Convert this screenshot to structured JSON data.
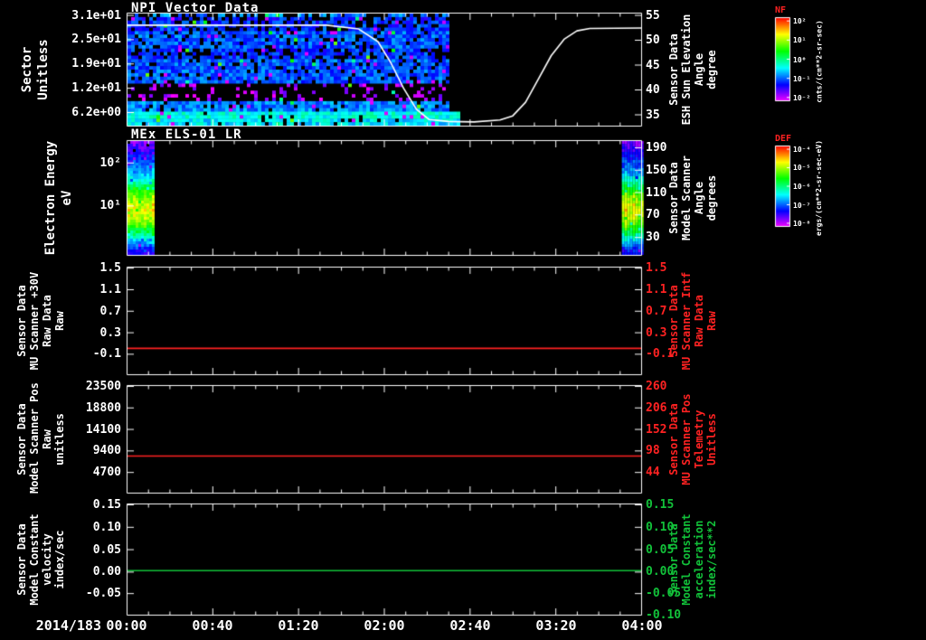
{
  "figure": {
    "background": "#000000",
    "foreground": "#ffffff"
  },
  "x_axis": {
    "date_label": "2014/183",
    "tick_labels": [
      "00:00",
      "00:40",
      "01:20",
      "02:00",
      "02:40",
      "03:20",
      "04:00"
    ],
    "range_hours": [
      0,
      4
    ]
  },
  "colorbars": [
    {
      "name": "NF",
      "name_color": "#ff2222",
      "unit_label": "cnts/(cm**2-sr-sec)",
      "tick_labels": [
        "10²",
        "10¹",
        "10⁰",
        "10⁻¹",
        "10⁻²"
      ]
    },
    {
      "name": "DEF",
      "name_color": "#ff2222",
      "unit_label": "ergs/(cm**2-sr-sec-eV)",
      "tick_labels": [
        "10⁻⁴",
        "10⁻⁵",
        "10⁻⁶",
        "10⁻⁷",
        "10⁻⁸"
      ]
    }
  ],
  "panels": [
    {
      "title": "NPI Vector Data",
      "left_axis": {
        "label_lines": [
          "Sector",
          "Unitless"
        ],
        "tick_labels": [
          "3.1e+01",
          "2.5e+01",
          "1.9e+01",
          "1.2e+01",
          "6.2e+00"
        ],
        "color": "#ffffff"
      },
      "right_axis": {
        "label_lines": [
          "Sensor Data",
          "ESH Sun Elevation",
          "Angle",
          "degree"
        ],
        "tick_labels": [
          "55",
          "50",
          "45",
          "40",
          "35"
        ],
        "color": "#ffffff"
      }
    },
    {
      "title": "MEx ELS-01 LR",
      "left_axis": {
        "label_lines": [
          "Electron Energy",
          "eV"
        ],
        "tick_labels": [
          "10²",
          "10¹"
        ],
        "color": "#ffffff"
      },
      "right_axis": {
        "label_lines": [
          "Sensor Data",
          "Model Scanner",
          "Angle",
          "degrees"
        ],
        "tick_labels": [
          "190",
          "150",
          "110",
          "70",
          "30"
        ],
        "color": "#ffffff"
      }
    },
    {
      "title": "",
      "left_axis": {
        "label_lines": [
          "Sensor Data",
          "MU Scanner +30V",
          "Raw Data",
          "Raw"
        ],
        "tick_labels": [
          "1.5",
          "1.1",
          "0.7",
          "0.3",
          "-0.1"
        ],
        "color": "#ffffff"
      },
      "right_axis": {
        "label_lines": [
          "Sensor Data",
          "MU Scanner Intf",
          "Raw Data",
          "Raw"
        ],
        "tick_labels": [
          "1.5",
          "1.1",
          "0.7",
          "0.3",
          "-0.1"
        ],
        "color": "#ff2222"
      }
    },
    {
      "title": "",
      "left_axis": {
        "label_lines": [
          "Sensor Data",
          "Model Scanner Pos",
          "Raw",
          "unitless"
        ],
        "tick_labels": [
          "23500",
          "18800",
          "14100",
          "9400",
          "4700"
        ],
        "color": "#ffffff"
      },
      "right_axis": {
        "label_lines": [
          "Sensor Data",
          "MU Scanner Pos",
          "Telemetry",
          "Unitless"
        ],
        "tick_labels": [
          "260",
          "206",
          "152",
          "98",
          "44"
        ],
        "color": "#ff2222"
      }
    },
    {
      "title": "",
      "left_axis": {
        "label_lines": [
          "Sensor Data",
          "Model Constant",
          "velocity",
          "index/sec"
        ],
        "tick_labels": [
          "0.15",
          "0.10",
          "0.05",
          "0.00",
          "-0.05"
        ],
        "color": "#ffffff"
      },
      "right_axis": {
        "label_lines": [
          "Sensor Data",
          "Model Constant",
          "acceleration",
          "index/sec**2"
        ],
        "tick_labels": [
          "0.15",
          "0.10",
          "0.05",
          "0.00",
          "-0.05",
          "-0.10"
        ],
        "color": "#12c23a"
      }
    }
  ],
  "chart_data": [
    {
      "type": "heatmap",
      "panel": 1,
      "title": "NPI Vector Data",
      "ylabel": "Sector (Unitless)",
      "y_ticks": [
        31,
        25,
        19,
        12,
        6.2
      ],
      "x_range_hours": [
        0,
        4
      ],
      "coverage_hours": [
        0,
        2.53
      ],
      "rows": 32,
      "row_mean_intensity": [
        0.3,
        0.22,
        0.24,
        0.24,
        0.24,
        0.27,
        0.27,
        0.27,
        0.27,
        0.27,
        0.24,
        0.24,
        0.24,
        0.27,
        0.27,
        0.27,
        0.27,
        0.27,
        0.27,
        0.27,
        0.06,
        0.06,
        0.06,
        0.06,
        0.06,
        0.3,
        0.3,
        0.3,
        0.42,
        0.42,
        0.38,
        0.38
      ],
      "row_gap_fraction": [
        0.4,
        0.35,
        0.25,
        0.25,
        0.25,
        0.12,
        0.12,
        0.12,
        0.12,
        0.12,
        0.3,
        0.3,
        0.3,
        0.1,
        0.1,
        0.1,
        0.1,
        0.1,
        0.1,
        0.1,
        0.75,
        0.75,
        0.75,
        0.75,
        0.75,
        0.08,
        0.08,
        0.08,
        0.02,
        0.02,
        0.05,
        0.05
      ],
      "colorbar": {
        "name": "NF",
        "units": "cnts/(cm**2-sr-sec)",
        "scale": [
          "10²",
          "10¹",
          "10⁰",
          "10⁻¹",
          "10⁻²"
        ]
      },
      "overlay_line": {
        "name": "Sensor Data ESH Sun Elevation Angle (degree)",
        "color": "#ffffff",
        "y_range": [
          32.5,
          56.5
        ],
        "y_ticks": [
          55,
          50,
          45,
          40,
          35
        ],
        "points": [
          [
            0,
            54
          ],
          [
            1.55,
            54
          ],
          [
            1.8,
            53.2
          ],
          [
            1.95,
            50.5
          ],
          [
            2.05,
            46
          ],
          [
            2.15,
            40.5
          ],
          [
            2.25,
            36
          ],
          [
            2.35,
            33.8
          ],
          [
            2.5,
            33.4
          ],
          [
            2.7,
            33.3
          ],
          [
            2.9,
            33.7
          ],
          [
            3.0,
            34.6
          ],
          [
            3.1,
            37.5
          ],
          [
            3.2,
            42.5
          ],
          [
            3.3,
            47.5
          ],
          [
            3.4,
            51
          ],
          [
            3.5,
            52.8
          ],
          [
            3.6,
            53.3
          ],
          [
            4.0,
            53.4
          ]
        ]
      }
    },
    {
      "type": "heatmap",
      "panel": 2,
      "title": "MEx ELS-01 LR",
      "ylabel": "Electron Energy (eV)",
      "y_scale": "log",
      "y_ticks": [
        "10²",
        "10¹"
      ],
      "x_range_hours": [
        0,
        4
      ],
      "coverage_hours": [
        [
          0,
          0.21
        ],
        [
          3.85,
          4.0
        ]
      ],
      "energy_profile_top_to_bottom": [
        0.1,
        0.16,
        0.22,
        0.28,
        0.34,
        0.44,
        0.58,
        0.7,
        0.78,
        0.8,
        0.76,
        0.66,
        0.52,
        0.38,
        0.24,
        0.14
      ],
      "colorbar": {
        "name": "DEF",
        "units": "ergs/(cm**2-sr-sec-eV)",
        "scale": [
          "10⁻⁴",
          "10⁻⁵",
          "10⁻⁶",
          "10⁻⁷",
          "10⁻⁸"
        ]
      },
      "right_axis": {
        "name": "Sensor Data Model Scanner Angle (degrees)",
        "y_ticks": [
          190,
          150,
          110,
          70,
          30
        ]
      }
    },
    {
      "type": "line",
      "panel": 3,
      "ylabel_left": "Sensor Data MU Scanner +30V Raw Data (Raw)",
      "ylabel_right": "Sensor Data MU Scanner Intf Raw Data (Raw)",
      "y_ticks": [
        1.5,
        1.1,
        0.7,
        0.3,
        -0.1
      ],
      "ylim": [
        -0.48,
        1.5
      ],
      "series": [
        {
          "name": "MU Scanner Intf Raw",
          "color": "#ff2222",
          "constant_value": 0.0
        }
      ]
    },
    {
      "type": "line",
      "panel": 4,
      "ylabel_left": "Sensor Data Model Scanner Pos Raw (unitless)",
      "ylabel_right": "Sensor Data MU Scanner Pos Telemetry (Unitless)",
      "y_ticks_left": [
        23500,
        18800,
        14100,
        9400,
        4700
      ],
      "y_ticks_right": [
        260,
        206,
        152,
        98,
        44
      ],
      "ylim_left": [
        200,
        23500
      ],
      "series": [
        {
          "name": "Scanner Pos",
          "color": "#ff2222",
          "constant_value": 8200
        }
      ]
    },
    {
      "type": "line",
      "panel": 5,
      "ylabel_left": "Sensor Data Model Constant velocity (index/sec)",
      "ylabel_right": "Sensor Data Model Constant acceleration (index/sec**2)",
      "y_ticks": [
        0.15,
        0.1,
        0.05,
        0.0,
        -0.05,
        -0.1
      ],
      "ylim": [
        -0.1,
        0.15
      ],
      "series": [
        {
          "name": "Model Constant",
          "color": "#12c23a",
          "constant_value": 0.0
        }
      ]
    }
  ]
}
